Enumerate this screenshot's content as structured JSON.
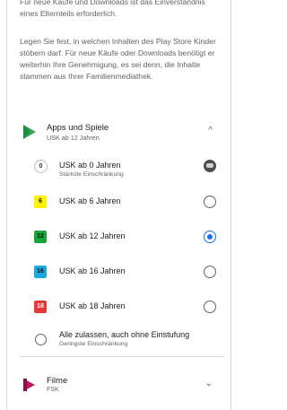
{
  "intro": {
    "paragraph1": "Für neue Käufe und Downloads ist das Einverständnis eines Elternteils erforderlich.",
    "paragraph2": "Legen Sie fest, in welchen Inhalten des Play Store Kinder stöbern darf. Für neue Käufe oder Downloads benötigt er weiterhin Ihre Genehmigung, es sei denn, die Inhalte stammen aus Ihrer Familienmediathek."
  },
  "apps_section": {
    "title": "Apps und Spiele",
    "subtitle": "USK ab 12 Jahren",
    "expanded_icon": "chevron-up-icon"
  },
  "ratings": [
    {
      "badge": "0",
      "label": "USK ab 0 Jahren",
      "sublabel": "Stärkste Einschränkung",
      "state": "locked",
      "badge_color": "#ffffff"
    },
    {
      "badge": "6",
      "label": "USK ab 6 Jahren",
      "sublabel": "",
      "state": "unselected",
      "badge_color": "#fff200"
    },
    {
      "badge": "12",
      "label": "USK ab 12 Jahren",
      "sublabel": "",
      "state": "selected",
      "badge_color": "#18a33b"
    },
    {
      "badge": "16",
      "label": "USK ab 16 Jahren",
      "sublabel": "",
      "state": "unselected",
      "badge_color": "#1ea7e1"
    },
    {
      "badge": "18",
      "label": "USK ab 18 Jahren",
      "sublabel": "",
      "state": "unselected",
      "badge_color": "#e53935"
    }
  ],
  "allow_all": {
    "label": "Alle zulassen, auch ohne Einstufung",
    "sublabel": "Geringste Einschränkung"
  },
  "films_section": {
    "title": "Filme",
    "subtitle": "FSK",
    "expanded_icon": "chevron-down-icon"
  },
  "colors": {
    "accent": "#1a73e8",
    "play_green": "#34a853",
    "film_red": "#c2185b"
  }
}
